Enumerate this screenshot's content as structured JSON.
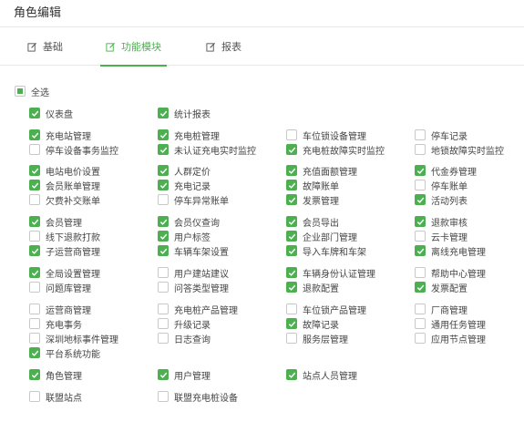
{
  "page_title": "角色编辑",
  "tabs": [
    {
      "label": "基础",
      "active": false
    },
    {
      "label": "功能模块",
      "active": true
    },
    {
      "label": "报表",
      "active": false
    }
  ],
  "select_all": {
    "label": "全选",
    "state": "partial"
  },
  "accent_color": "#4caf50",
  "groups": [
    {
      "items": [
        {
          "label": "仪表盘",
          "checked": true
        },
        {
          "label": "统计报表",
          "checked": true
        }
      ]
    },
    {
      "items": [
        {
          "label": "充电站管理",
          "checked": true
        },
        {
          "label": "充电桩管理",
          "checked": true
        },
        {
          "label": "车位锁设备管理",
          "checked": false
        },
        {
          "label": "停车记录",
          "checked": false
        },
        {
          "label": "停车设备事务监控",
          "checked": false
        },
        {
          "label": "未认证充电实时监控",
          "checked": true
        },
        {
          "label": "充电桩故障实时监控",
          "checked": true
        },
        {
          "label": "地锁故障实时监控",
          "checked": false
        }
      ]
    },
    {
      "items": [
        {
          "label": "电站电价设置",
          "checked": true
        },
        {
          "label": "人群定价",
          "checked": true
        },
        {
          "label": "充值面额管理",
          "checked": true
        },
        {
          "label": "代金券管理",
          "checked": true
        },
        {
          "label": "会员账单管理",
          "checked": true
        },
        {
          "label": "充电记录",
          "checked": true
        },
        {
          "label": "故障账单",
          "checked": true
        },
        {
          "label": "停车账单",
          "checked": false
        },
        {
          "label": "欠费补交账单",
          "checked": false
        },
        {
          "label": "停车异常账单",
          "checked": false
        },
        {
          "label": "发票管理",
          "checked": true
        },
        {
          "label": "活动列表",
          "checked": true
        }
      ]
    },
    {
      "items": [
        {
          "label": "会员管理",
          "checked": true
        },
        {
          "label": "会员仪查询",
          "checked": true
        },
        {
          "label": "会员导出",
          "checked": true
        },
        {
          "label": "退款审核",
          "checked": true
        },
        {
          "label": "线下退款打款",
          "checked": false
        },
        {
          "label": "用户标签",
          "checked": true
        },
        {
          "label": "企业部门管理",
          "checked": true
        },
        {
          "label": "云卡管理",
          "checked": false
        },
        {
          "label": "子运营商管理",
          "checked": true
        },
        {
          "label": "车辆车架设置",
          "checked": true
        },
        {
          "label": "导入车牌和车架",
          "checked": true
        },
        {
          "label": "离线充电管理",
          "checked": true
        }
      ]
    },
    {
      "items": [
        {
          "label": "全局设置管理",
          "checked": true
        },
        {
          "label": "用户建站建议",
          "checked": false
        },
        {
          "label": "车辆身份认证管理",
          "checked": true
        },
        {
          "label": "帮助中心管理",
          "checked": false
        },
        {
          "label": "问题库管理",
          "checked": false
        },
        {
          "label": "问答类型管理",
          "checked": false
        },
        {
          "label": "退款配置",
          "checked": true
        },
        {
          "label": "发票配置",
          "checked": true
        }
      ]
    },
    {
      "items": [
        {
          "label": "运营商管理",
          "checked": false
        },
        {
          "label": "充电桩产品管理",
          "checked": false
        },
        {
          "label": "车位锁产品管理",
          "checked": false
        },
        {
          "label": "厂商管理",
          "checked": false
        },
        {
          "label": "充电事务",
          "checked": false
        },
        {
          "label": "升级记录",
          "checked": false
        },
        {
          "label": "故障记录",
          "checked": true
        },
        {
          "label": "通用任务管理",
          "checked": false
        },
        {
          "label": "深圳地标事件管理",
          "checked": false
        },
        {
          "label": "日志查询",
          "checked": false
        },
        {
          "label": "服务层管理",
          "checked": false
        },
        {
          "label": "应用节点管理",
          "checked": false
        },
        {
          "label": "平台系统功能",
          "checked": true
        }
      ]
    },
    {
      "items": [
        {
          "label": "角色管理",
          "checked": true
        },
        {
          "label": "用户管理",
          "checked": true
        },
        {
          "label": "站点人员管理",
          "checked": true
        }
      ]
    },
    {
      "items": [
        {
          "label": "联盟站点",
          "checked": false
        },
        {
          "label": "联盟充电桩设备",
          "checked": false
        }
      ]
    }
  ]
}
